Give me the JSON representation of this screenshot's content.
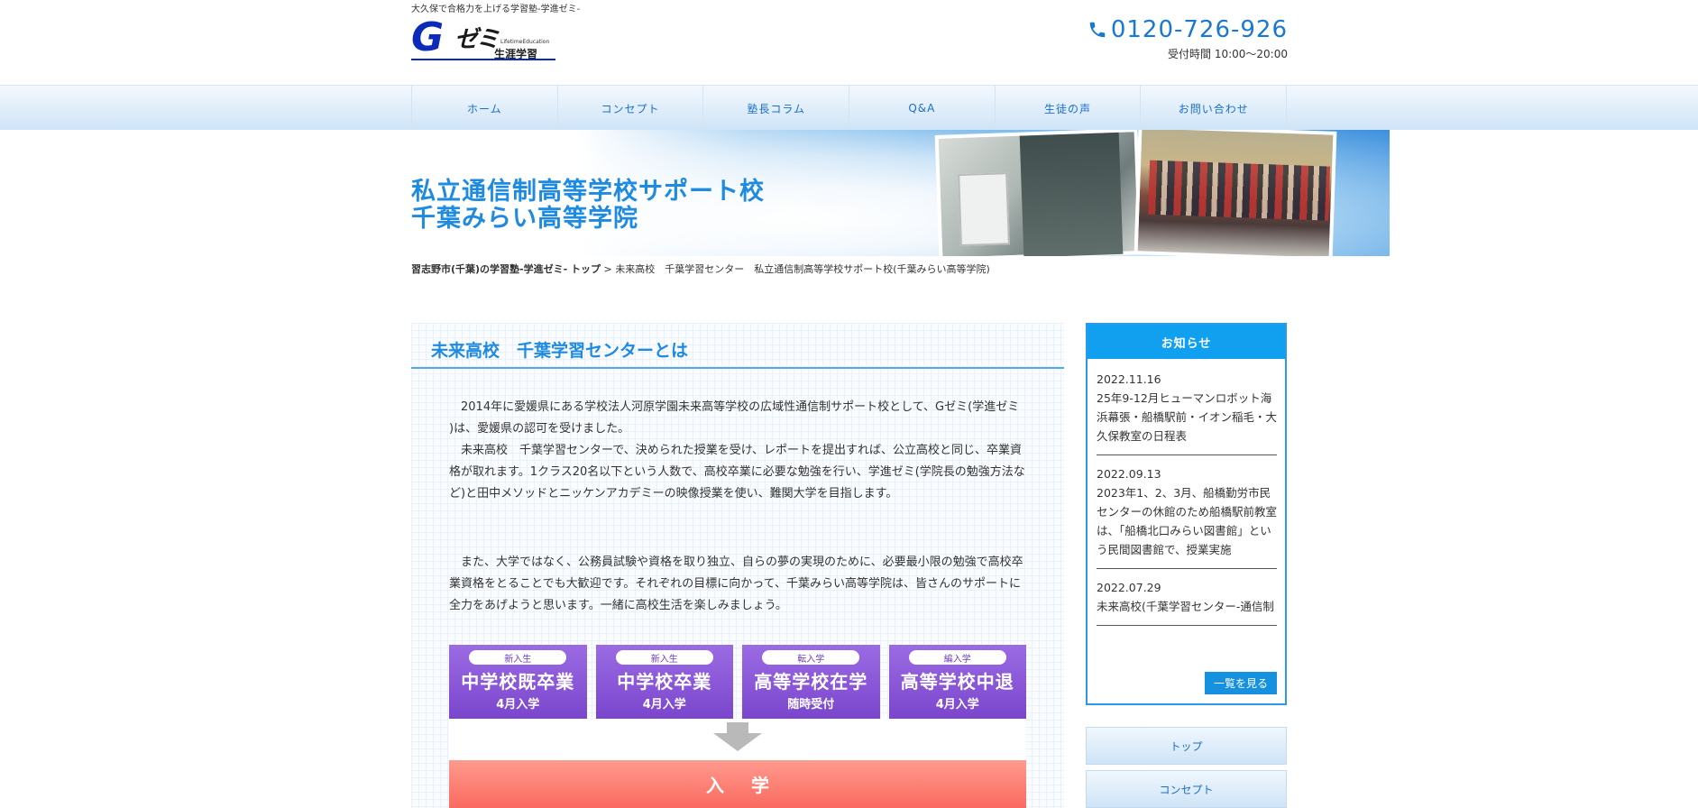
{
  "header": {
    "tagline": "大久保で合格力を上げる学習塾-学進ゼミ-",
    "logo": {
      "mark": "G",
      "zemi": "ゼミ",
      "sub": "LifetimeEducation",
      "name": "生涯学習"
    },
    "phone": "0120-726-926",
    "hours": "受付時間 10:00〜20:00"
  },
  "nav": {
    "items": [
      "ホーム",
      "コンセプト",
      "塾長コラム",
      "Q&A",
      "生徒の声",
      "お問い合わせ"
    ]
  },
  "hero": {
    "title_line1": "私立通信制高等学校サポート校",
    "title_line2": "千葉みらい高等学院"
  },
  "breadcrumb": {
    "home": "習志野市(千葉)の学習塾-学進ゼミ- トップ",
    "separator": ">",
    "current": "未来高校　千葉学習センター　私立通信制高等学校サポート校(千葉みらい高等学院)"
  },
  "main": {
    "heading": "未来高校　千葉学習センターとは",
    "paragraph1": "　2014年に愛媛県にある学校法人河原学園未来高等学校の広域性通信制サポート校として、Gゼミ(学進ゼミ )は、愛媛県の認可を受けました。\n　未来高校　千葉学習センターで、決められた授業を受け、レポートを提出すれば、公立高校と同じ、卒業資格が取れます。1クラス20名以下という人数で、高校卒業に必要な勉強を行い、学進ゼミ(学院長の勉強方法など)と田中メソッドとニッケンアカデミーの映像授業を使い、難関大学を目指します。",
    "paragraph2": "　また、大学ではなく、公務員試験や資格を取り独立、自らの夢の実現のために、必要最小限の勉強で高校卒業資格をとることでも大歓迎です。それぞれの目標に向かって、千葉みらい高等学院は、皆さんのサポートに全力をあげようと思います。一緒に高校生活を楽しみましょう。",
    "entry_boxes": [
      {
        "tag": "新入生",
        "title": "中学校既卒業",
        "sub": "4月入学"
      },
      {
        "tag": "新入生",
        "title": "中学校卒業",
        "sub": "4月入学"
      },
      {
        "tag": "転入学",
        "title": "高等学校在学",
        "sub": "随時受付"
      },
      {
        "tag": "編入学",
        "title": "高等学校中退",
        "sub": "4月入学"
      }
    ],
    "admission": "入学"
  },
  "sidebar": {
    "news_title": "お知らせ",
    "news": [
      {
        "date": "2022.11.16",
        "text": "25年9-12月ヒューマンロボット海浜幕張・船橋駅前・イオン稲毛・大久保教室の日程表"
      },
      {
        "date": "2022.09.13",
        "text": "2023年1、2、3月、船橋勤労市民センターの休館のため船橋駅前教室は、「船橋北口みらい図書館」という民間図書館で、授業実施"
      },
      {
        "date": "2022.07.29",
        "text": "未来高校(千葉学習センター-通信制"
      }
    ],
    "more_label": "一覧を見る",
    "links": [
      "トップ",
      "コンセプト"
    ]
  },
  "colors": {
    "accent_blue": "#1e8ae0",
    "nav_text": "#1a6fc8",
    "entry_purple": "#7a46cd",
    "admission_red": "#fa6a60"
  },
  "icons": {
    "phone": "phone-icon",
    "arrow": "arrow-down-icon"
  }
}
